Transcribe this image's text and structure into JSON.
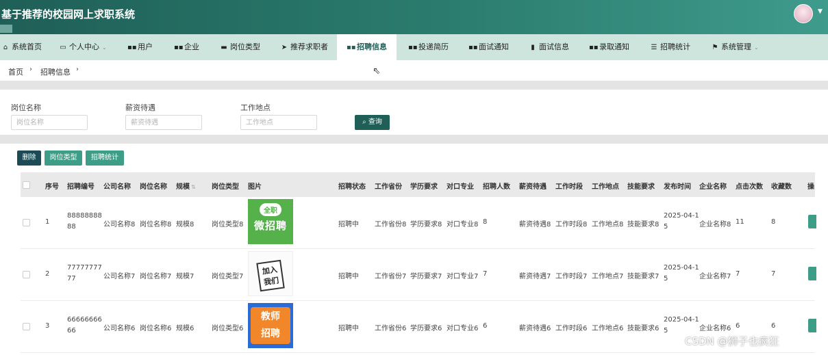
{
  "app": {
    "title": "基于推荐的校园网上求职系统"
  },
  "nav": {
    "items": [
      {
        "icon": "home-icon",
        "glyph": "⌂",
        "label": "系统首页",
        "caret": false
      },
      {
        "icon": "user-card-icon",
        "glyph": "▭",
        "label": "个人中心",
        "caret": true
      },
      {
        "icon": "grid-icon",
        "glyph": "▪▪",
        "label": "用户",
        "caret": false
      },
      {
        "icon": "grid-icon",
        "glyph": "▪▪",
        "label": "企业",
        "caret": false
      },
      {
        "icon": "briefcase-icon",
        "glyph": "▬",
        "label": "岗位类型",
        "caret": false
      },
      {
        "icon": "send-icon",
        "glyph": "➤",
        "label": "推荐求职者",
        "caret": false
      },
      {
        "icon": "grid-icon",
        "glyph": "▪▪",
        "label": "招聘信息",
        "caret": false,
        "active": true
      },
      {
        "icon": "grid-icon",
        "glyph": "▪▪",
        "label": "投递简历",
        "caret": false
      },
      {
        "icon": "grid-icon",
        "glyph": "▪▪",
        "label": "面试通知",
        "caret": false
      },
      {
        "icon": "document-icon",
        "glyph": "▮",
        "label": "面试信息",
        "caret": false
      },
      {
        "icon": "grid-icon",
        "glyph": "▪▪",
        "label": "录取通知",
        "caret": false
      },
      {
        "icon": "sliders-icon",
        "glyph": "☰",
        "label": "招聘统计",
        "caret": false
      },
      {
        "icon": "flag-icon",
        "glyph": "⚑",
        "label": "系统管理",
        "caret": true
      }
    ]
  },
  "breadcrumb": {
    "home": "首页",
    "current": "招聘信息"
  },
  "search": {
    "fields": [
      {
        "label": "岗位名称",
        "placeholder": "岗位名称"
      },
      {
        "label": "薪资待遇",
        "placeholder": "薪资待遇"
      },
      {
        "label": "工作地点",
        "placeholder": "工作地点"
      }
    ],
    "button": "查询"
  },
  "actions": {
    "delete": "删除",
    "job_type": "岗位类型",
    "stats": "招聘统计"
  },
  "table": {
    "columns": [
      "序号",
      "招聘编号",
      "公司名称",
      "岗位名称",
      "规模",
      "岗位类型",
      "图片",
      "招聘状态",
      "工作省份",
      "学历要求",
      "对口专业",
      "招聘人数",
      "薪资待遇",
      "工作时段",
      "工作地点",
      "技能要求",
      "发布时间",
      "企业名称",
      "点击次数",
      "收藏数",
      "操"
    ],
    "rows": [
      {
        "index": "1",
        "code": "88888888 88",
        "company": "公司名称8",
        "position": "岗位名称8",
        "scale": "规模8",
        "type": "岗位类型8",
        "image": {
          "style": "green",
          "line1": "全职",
          "line2": "微招聘"
        },
        "status": "招聘中",
        "province": "工作省份8",
        "education": "学历要求8",
        "major": "对口专业8",
        "count": "8",
        "salary": "薪资待遇8",
        "period": "工作时段8",
        "location": "工作地点8",
        "skill": "技能要求8",
        "date": "2025-04-1 5",
        "enterprise": "企业名称8",
        "clicks": "11",
        "favorites": "8"
      },
      {
        "index": "2",
        "code": "77777777 77",
        "company": "公司名称7",
        "position": "岗位名称7",
        "scale": "规模7",
        "type": "岗位类型7",
        "image": {
          "style": "white",
          "line1": "加入",
          "line2": "我们"
        },
        "status": "招聘中",
        "province": "工作省份7",
        "education": "学历要求7",
        "major": "对口专业7",
        "count": "7",
        "salary": "薪资待遇7",
        "period": "工作时段7",
        "location": "工作地点7",
        "skill": "技能要求7",
        "date": "2025-04-1 5",
        "enterprise": "企业名称7",
        "clicks": "7",
        "favorites": "7"
      },
      {
        "index": "3",
        "code": "66666666 66",
        "company": "公司名称6",
        "position": "岗位名称6",
        "scale": "规模6",
        "type": "岗位类型6",
        "image": {
          "style": "blue",
          "line1": "教师",
          "line2": "招聘"
        },
        "status": "招聘中",
        "province": "工作省份6",
        "education": "学历要求6",
        "major": "对口专业6",
        "count": "6",
        "salary": "薪资待遇6",
        "period": "工作时段6",
        "location": "工作地点6",
        "skill": "技能要求6",
        "date": "2025-04-1 5",
        "enterprise": "企业名称6",
        "clicks": "6",
        "favorites": "6"
      }
    ]
  },
  "watermark": "CSDN @狮子也疯狂"
}
